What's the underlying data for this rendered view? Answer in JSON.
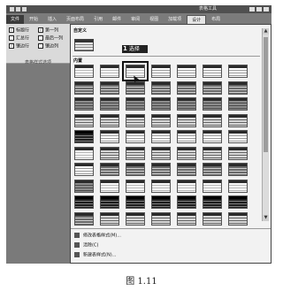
{
  "window": {
    "title": "表格工具"
  },
  "tabs": [
    "文件",
    "开始",
    "插入",
    "页面布局",
    "引用",
    "邮件",
    "审阅",
    "视图",
    "加载项",
    "设计",
    "布局"
  ],
  "style_options": {
    "items": [
      {
        "label": "标题行",
        "checked": true
      },
      {
        "label": "第一列",
        "checked": true
      },
      {
        "label": "汇总行",
        "checked": false
      },
      {
        "label": "最后一列",
        "checked": false
      },
      {
        "label": "镶边行",
        "checked": true
      },
      {
        "label": "镶边列",
        "checked": false
      }
    ],
    "group_label": "表格样式选项"
  },
  "gallery": {
    "custom_label": "自定义",
    "builtin_label": "内置",
    "callout_number": "1",
    "callout_text": "选择"
  },
  "menu": {
    "modify": "修改表格样式(M)...",
    "clear": "清除(C)",
    "new": "新建表样式(N)..."
  },
  "caption": "图 1.11"
}
